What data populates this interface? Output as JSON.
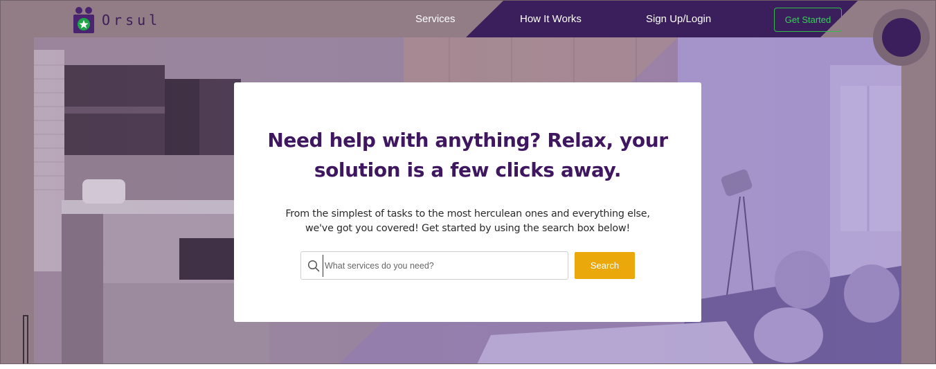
{
  "brand": {
    "name": "Orsul",
    "icon": "people-star-logo-icon",
    "primary_color": "#3f1760",
    "accent_color": "#eaa80b",
    "cta_color": "#37d05a"
  },
  "nav": {
    "links": [
      {
        "label": "Services"
      },
      {
        "label": "How It Works"
      },
      {
        "label": "Sign Up/Login"
      }
    ],
    "cta_label": "Get Started"
  },
  "hero": {
    "headline": "Need help with anything? Relax, your solution is a few clicks away.",
    "subtext": "From the simplest of tasks to the most herculean ones and everything else, we've got you covered! Get started by using the search box below!",
    "search": {
      "placeholder": "What services do you need?",
      "value": "",
      "icon": "search-icon",
      "button_label": "Search"
    }
  }
}
